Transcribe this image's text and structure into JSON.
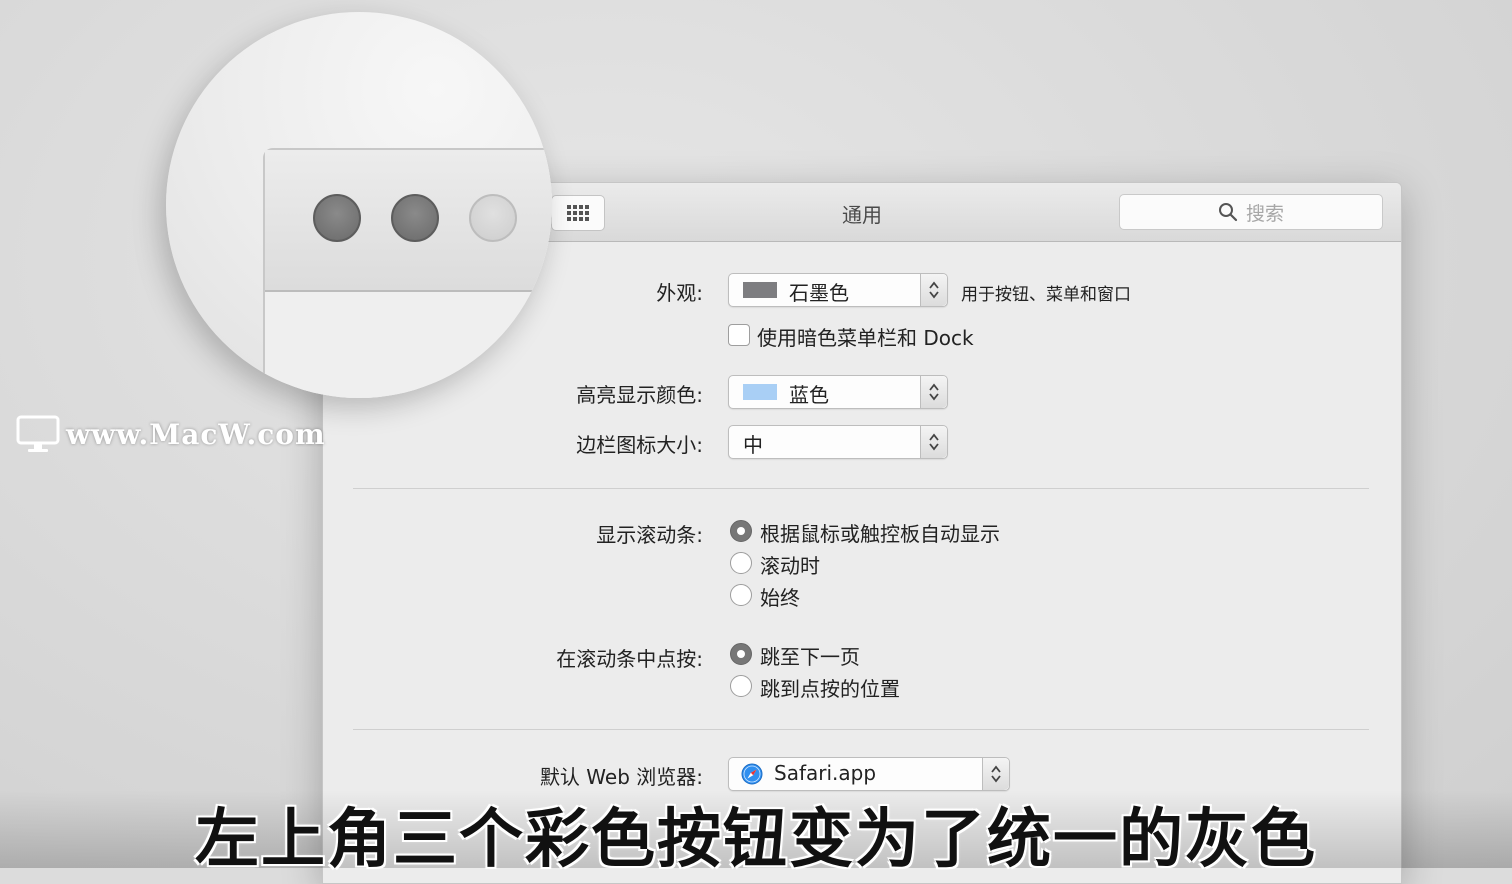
{
  "window": {
    "title": "通用",
    "search_placeholder": "搜索"
  },
  "appearance": {
    "label": "外观:",
    "value": "石墨色",
    "swatch_color": "#7d7d80",
    "note": "用于按钮、菜单和窗口",
    "dark_menu_label": "使用暗色菜单栏和 Dock",
    "dark_menu_checked": false
  },
  "highlight": {
    "label": "高亮显示颜色:",
    "value": "蓝色",
    "swatch_color": "#a9cff5"
  },
  "sidebar_icon": {
    "label": "边栏图标大小:",
    "value": "中"
  },
  "scrollbars": {
    "label": "显示滚动条:",
    "options": [
      "根据鼠标或触控板自动显示",
      "滚动时",
      "始终"
    ],
    "selected": 0
  },
  "click_scroll": {
    "label": "在滚动条中点按:",
    "options": [
      "跳至下一页",
      "跳到点按的位置"
    ],
    "selected": 0
  },
  "browser": {
    "label": "默认 Web 浏览器:",
    "value": "Safari.app"
  },
  "watermark": "www.MacW.com",
  "caption": "左上角三个彩色按钮变为了统一的灰色"
}
